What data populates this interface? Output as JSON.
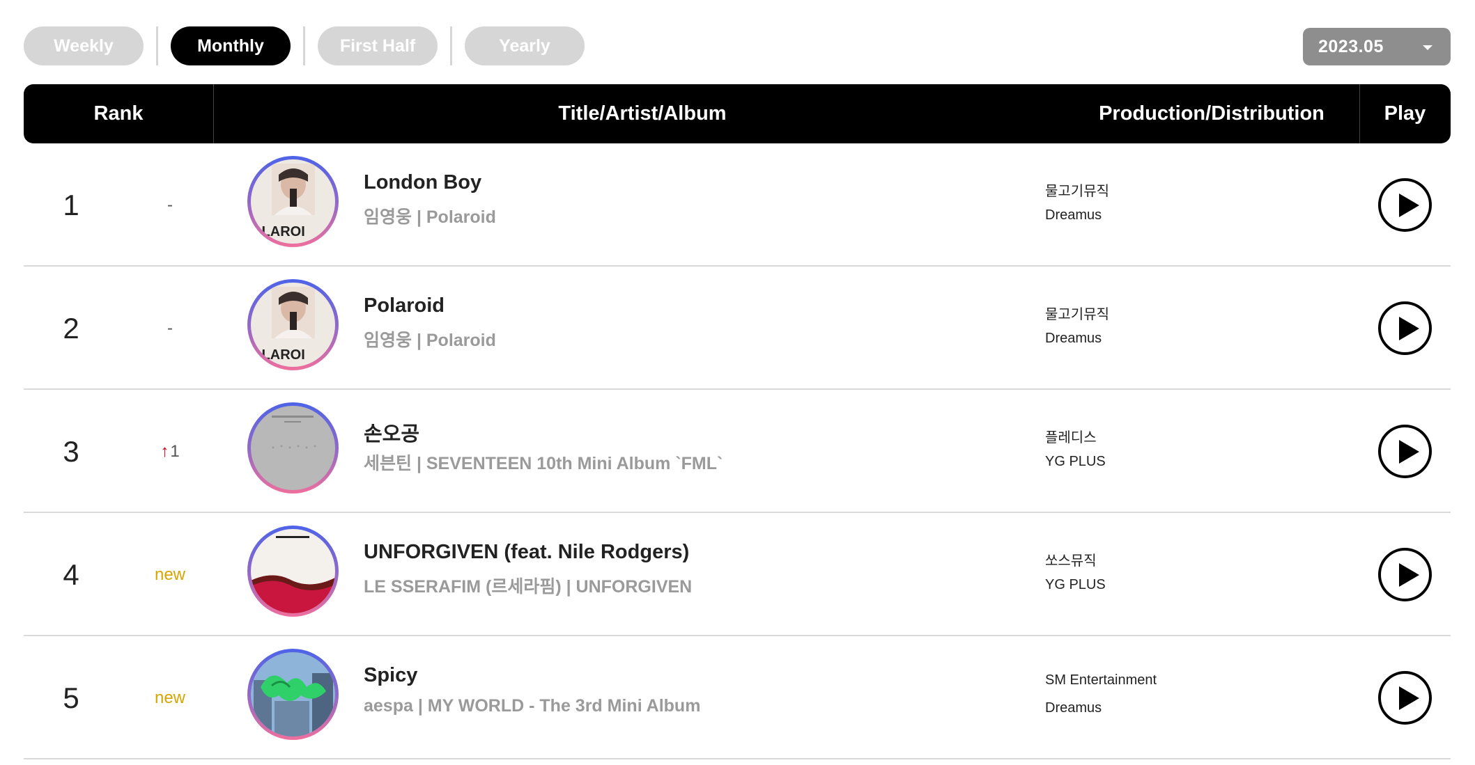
{
  "tabs": [
    {
      "label": "Weekly",
      "active": false
    },
    {
      "label": "Monthly",
      "active": true
    },
    {
      "label": "First Half",
      "active": false
    },
    {
      "label": "Yearly",
      "active": false
    }
  ],
  "period_select": {
    "value": "2023.05"
  },
  "table_header": {
    "rank": "Rank",
    "title": "Title/Artist/Album",
    "production": "Production/Distribution",
    "play": "Play"
  },
  "rows": [
    {
      "rank": "1",
      "change": "-",
      "title": "London Boy",
      "artist_album": "임영웅 | Polaroid",
      "production": "물고기뮤직",
      "distribution": "Dreamus",
      "cover_icon": "polaroid-album-cover"
    },
    {
      "rank": "2",
      "change": "-",
      "title": "Polaroid",
      "artist_album": "임영웅 | Polaroid",
      "production": "물고기뮤직",
      "distribution": "Dreamus",
      "cover_icon": "polaroid-album-cover"
    },
    {
      "rank": "3",
      "change_arrow": "↑",
      "change": "1",
      "title": "손오공",
      "artist_album": "세븐틴 | SEVENTEEN 10th Mini Album `FML`",
      "production": "플레디스",
      "distribution": "YG PLUS",
      "cover_icon": "fml-album-cover"
    },
    {
      "rank": "4",
      "change": "new",
      "title": "UNFORGIVEN (feat. Nile Rodgers)",
      "artist_album": "LE SSERAFIM (르세라핌) | UNFORGIVEN",
      "production": "쏘스뮤직",
      "distribution": "YG PLUS",
      "cover_icon": "unforgiven-album-cover"
    },
    {
      "rank": "5",
      "change": "new",
      "title": "Spicy",
      "artist_album": "aespa | MY WORLD - The 3rd Mini Album",
      "production": "SM Entertainment",
      "distribution": "Dreamus",
      "cover_icon": "my-world-album-cover"
    }
  ],
  "colors": {
    "header_bg": "#000000",
    "tab_inactive": "#d6d6d6",
    "period_bg": "#8e8e8e",
    "new_badge": "#d8a400",
    "up_arrow": "#d0021b",
    "subtext": "#9a9a9a"
  }
}
